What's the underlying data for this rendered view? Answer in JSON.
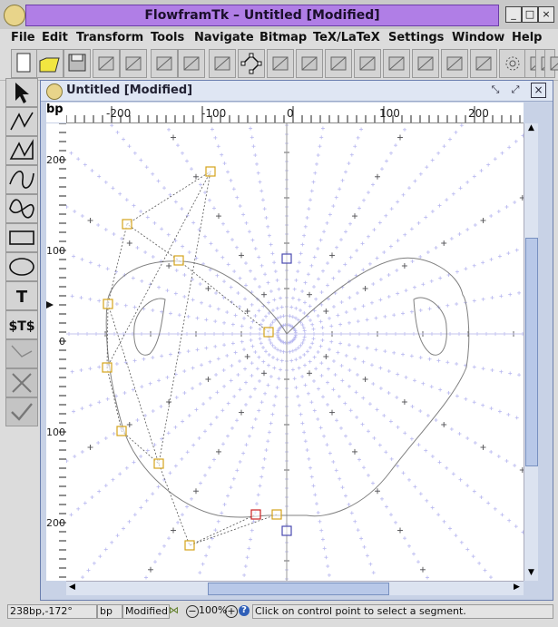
{
  "window": {
    "title": "FlowframTk – Untitled [Modified]"
  },
  "menu": [
    "File",
    "Edit",
    "Transform",
    "Tools",
    "Navigate",
    "Bitmap",
    "TeX/LaTeX",
    "Settings",
    "Window",
    "Help"
  ],
  "toolbar_icons": [
    "new-icon",
    "open-icon",
    "save-icon",
    "select-area-icon",
    "cut-icon",
    "paste-icon",
    "group-icon",
    "ungroup-icon",
    "edit-path-icon",
    "front-icon",
    "back-icon",
    "reduce-icon",
    "rotate-icon",
    "scale-icon",
    "shear-icon",
    "distort-icon",
    "pattern-icon",
    "star-icon",
    "grid-icon",
    "snap-icon",
    "more-icon"
  ],
  "tools": [
    "select-icon",
    "line-icon",
    "closed-line-icon",
    "curve-icon",
    "closed-curve-icon",
    "rectangle-icon",
    "ellipse-icon",
    "text-icon",
    "math-text-icon",
    "edit-off-icon",
    "cancel-icon",
    "confirm-icon"
  ],
  "tool_labels": {
    "text": "T",
    "math": "$T$"
  },
  "doc": {
    "title": "Untitled [Modified]",
    "units": "bp"
  },
  "hruler": {
    "labels": [
      "-200",
      "-100",
      "0",
      "100",
      "200"
    ]
  },
  "vruler": {
    "labels": [
      "200",
      "100",
      "0",
      "100",
      "200"
    ]
  },
  "status": {
    "position": "238bp,-172°",
    "units": "bp",
    "modified": "Modified",
    "zoom": "100%",
    "hint": "Click on control point to select a segment."
  }
}
